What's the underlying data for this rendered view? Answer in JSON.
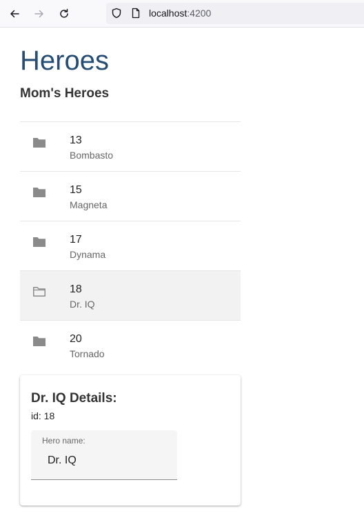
{
  "browser": {
    "url_host": "localhost",
    "url_port": ":4200",
    "back_icon": "arrow-left-icon",
    "forward_icon": "arrow-right-icon",
    "reload_icon": "reload-icon",
    "security_icon": "shield-icon",
    "page_icon": "page-icon"
  },
  "page": {
    "title": "Heroes",
    "list_title": "Mom's Heroes"
  },
  "heroes": [
    {
      "id": "13",
      "name": "Bombasto",
      "icon": "folder-icon",
      "selected": false
    },
    {
      "id": "15",
      "name": "Magneta",
      "icon": "folder-icon",
      "selected": false
    },
    {
      "id": "17",
      "name": "Dynama",
      "icon": "folder-icon",
      "selected": false
    },
    {
      "id": "18",
      "name": "Dr. IQ",
      "icon": "folder-open-outline-icon",
      "selected": true
    },
    {
      "id": "20",
      "name": "Tornado",
      "icon": "folder-icon",
      "selected": false
    }
  ],
  "details": {
    "title": "Dr. IQ Details:",
    "id_text": "id: 18",
    "field_label": "Hero name:",
    "field_value": "Dr. IQ"
  },
  "colors": {
    "title": "#264d73",
    "folder_icon": "#8a8a8a",
    "selected_row": "#f2f2f2"
  }
}
